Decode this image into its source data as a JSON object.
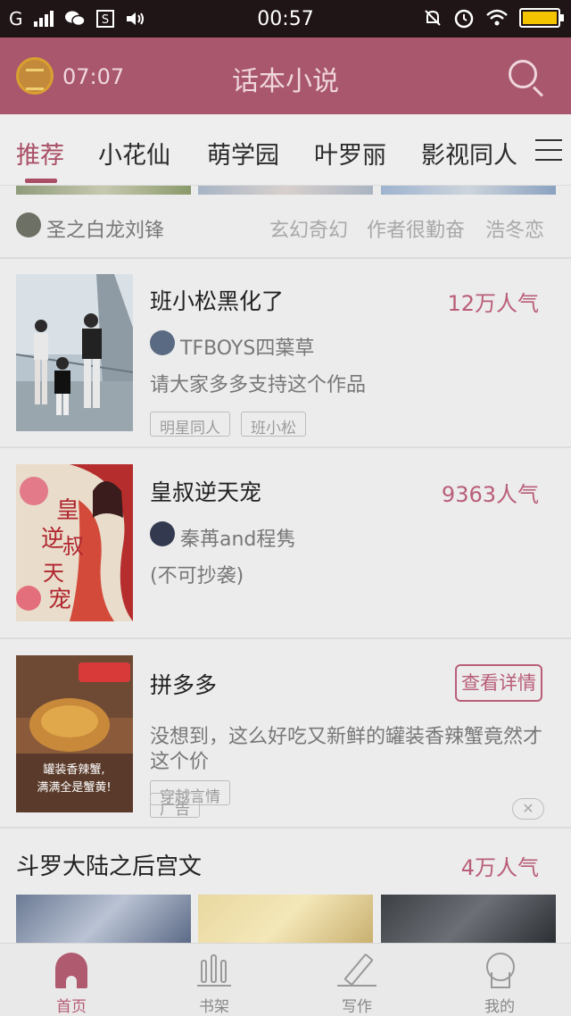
{
  "status_bar": {
    "network": "G",
    "time": "00:57",
    "wechat_icon": "wechat-icon",
    "sim_icon": "s-icon",
    "volume_icon": "volume-icon",
    "mute_icon": "notification-off-icon",
    "alarm_icon": "alarm-icon",
    "wifi_icon": "wifi-icon",
    "battery_icon": "battery-icon",
    "battery_color": "#f5c400"
  },
  "header": {
    "alarm_time": "07:07",
    "title": "话本小说",
    "search_icon": "search-icon",
    "background": "#a9576d"
  },
  "tabs": [
    "推荐",
    "小花仙",
    "萌学园",
    "叶罗丽",
    "影视同人"
  ],
  "active_tab": "推荐",
  "top_strip": {
    "author": "圣之白龙刘锋",
    "tags": [
      "玄幻奇幻",
      "作者很勤奋",
      "浩冬恋"
    ]
  },
  "books": [
    {
      "title": "班小松黑化了",
      "popularity": "12万人气",
      "author": "TFBOYS四葉草",
      "description": "请大家多多支持这个作品",
      "tags": [
        "明星同人",
        "班小松"
      ]
    },
    {
      "title": "皇叔逆天宠",
      "popularity": "9363人气",
      "author": "秦苒and程隽",
      "description": "(不可抄袭)",
      "tags": [
        "穿越言情"
      ]
    }
  ],
  "ad": {
    "title": "拼多多",
    "button": "查看详情",
    "description": "没想到，这么好吃又新鲜的罐装香辣蟹竟然才这个价",
    "tag": "广告",
    "close": "✕"
  },
  "section": {
    "title": "斗罗大陆之后宫文",
    "popularity": "4万人气"
  },
  "bottom_nav": [
    {
      "label": "首页",
      "icon": "home-icon"
    },
    {
      "label": "书架",
      "icon": "bookshelf-icon"
    },
    {
      "label": "写作",
      "icon": "pen-icon"
    },
    {
      "label": "我的",
      "icon": "profile-icon"
    }
  ],
  "accent_color": "#b95e78"
}
